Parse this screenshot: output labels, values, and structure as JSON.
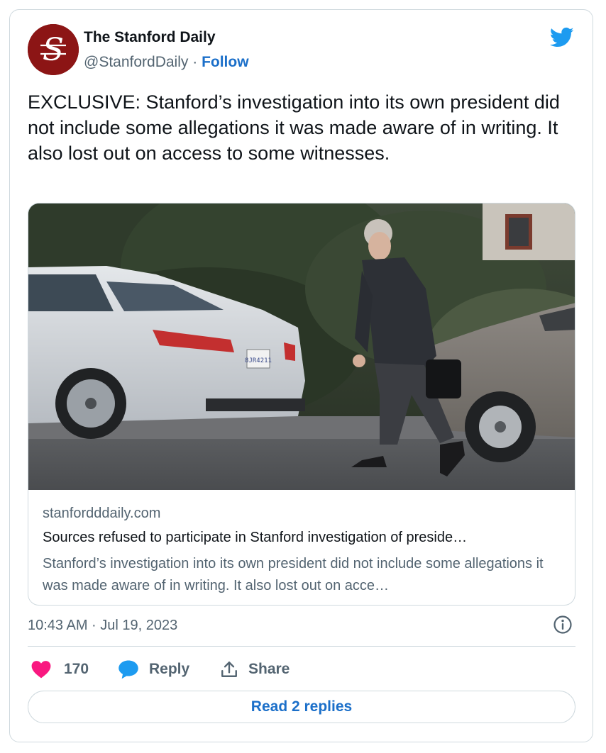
{
  "tweet": {
    "author_name": "The Stanford Daily",
    "handle": "@StanfordDaily",
    "separator": " · ",
    "follow_label": "Follow",
    "avatar_letter": "S",
    "text": "EXCLUSIVE: Stanford’s investigation into its own president did not include some allegations it was made aware of in writing. It also lost out on access to some witnesses.",
    "timestamp": "10:43 AM · Jul 19, 2023"
  },
  "link_card": {
    "domain": "stanfordddaily.com",
    "title": "Sources refused to participate in Stanford investigation of preside…",
    "description": "Stanford’s investigation into its own president did not include some allegations it was made aware of in writing. It also lost out on acce…",
    "plate_text": "8JR4211"
  },
  "actions": {
    "like_count": "170",
    "reply_label": "Reply",
    "share_label": "Share",
    "read_replies_label": "Read 2 replies"
  },
  "colors": {
    "brand_red": "#8c1515",
    "link_blue": "#1b6fc9",
    "twitter_blue": "#1d9bf0",
    "like_pink": "#f91880",
    "muted_text": "#536471",
    "border": "#cfd9de"
  },
  "icons": {
    "logo": "twitter-bird-icon",
    "info": "info-icon",
    "like": "heart-icon",
    "reply": "speech-bubble-icon",
    "share": "share-upload-icon"
  }
}
